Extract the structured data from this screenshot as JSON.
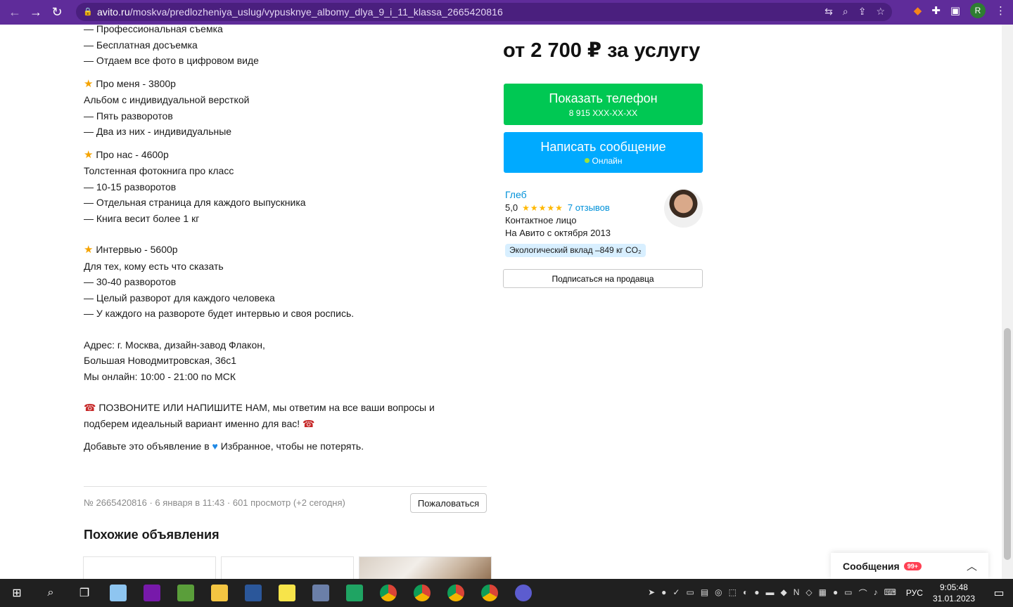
{
  "browser": {
    "url_host": "avito.ru",
    "url_path": "/moskva/predlozheniya_uslug/vypusknye_albomy_dlya_9_i_11_klassa_2665420816",
    "profile_initial": "R"
  },
  "description": {
    "lines_top": [
      "— Профессиональная съемка",
      "— Бесплатная досъемка",
      "— Отдаем все фото в цифровом виде"
    ],
    "pkg1": {
      "title": "Про меня - 3800р",
      "lines": [
        "Альбом с индивидуальной версткой",
        "— Пять разворотов",
        "— Два из них - индивидуальные"
      ]
    },
    "pkg2": {
      "title": "Про нас - 4600р",
      "lines": [
        "Толстенная фотокнига про класс",
        "— 10-15 разворотов",
        "— Отдельная страница для каждого выпускника",
        "— Книга весит более 1 кг"
      ]
    },
    "pkg3": {
      "title": "Интервью - 5600р",
      "lines": [
        "Для тех, кому есть что сказать",
        "— 30-40 разворотов",
        "— Целый разворот для каждого человека",
        "— У каждого на развороте будет интервью и своя роспись."
      ]
    },
    "address": [
      "Адрес: г. Москва, дизайн-завод Флакон,",
      "Большая Новодмитровская, 36с1",
      "Мы онлайн: 10:00 - 21:00 по МСК"
    ],
    "call_line1": "ПОЗВОНИТЕ ИЛИ НАПИШИТЕ НАМ, мы ответим на все ваши вопросы и",
    "call_line2": "подберем идеальный вариант именно для вас!",
    "fav_before": "Добавьте это объявление в",
    "fav_after": "Избранное, чтобы не потерять."
  },
  "listing_meta": "№ 2665420816 · 6 января в 11:43 · 601 просмотр (+2 сегодня)",
  "complain_label": "Пожаловаться",
  "similar_title": "Похожие объявления",
  "price": "от 2 700 ₽ за услугу",
  "phone_button": {
    "label": "Показать телефон",
    "number": "8 915 XXX-XX-XX"
  },
  "message_button": {
    "label": "Написать сообщение",
    "status": "Онлайн"
  },
  "seller": {
    "name": "Глеб",
    "rating": "5,0",
    "stars": "★★★★★",
    "reviews": "7 отзывов",
    "role": "Контактное лицо",
    "since": "На Авито с октября 2013",
    "eco": "Экологический вклад –849 кг CO₂"
  },
  "subscribe_label": "Подписаться на продавца",
  "messages_widget": {
    "title": "Сообщения",
    "badge": "99+"
  },
  "taskbar": {
    "lang": "РУС",
    "time": "9:05:48",
    "date": "31.01.2023"
  },
  "colors": {
    "brand_purple": "#5f2c9a",
    "phone_green": "#00c853",
    "message_blue": "#00aaff",
    "link_blue": "#0091d9"
  }
}
